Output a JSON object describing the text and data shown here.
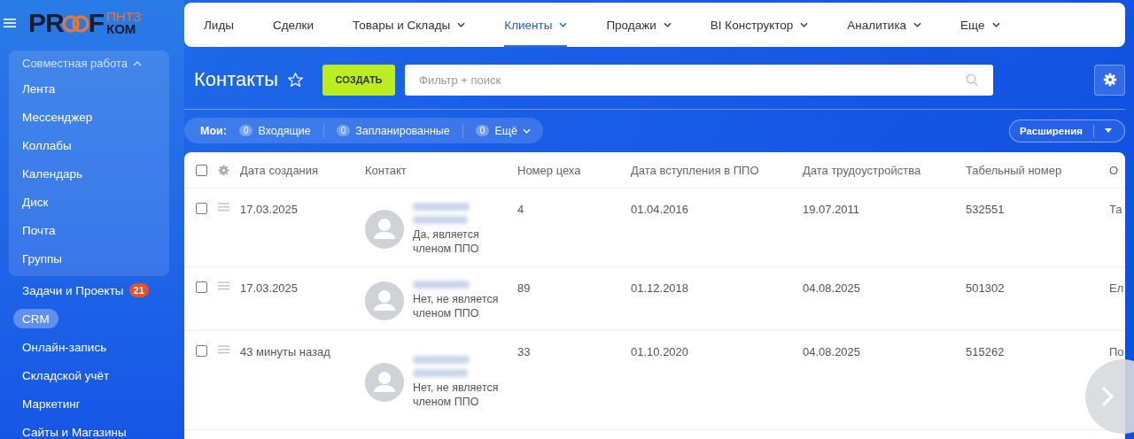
{
  "logo": {
    "left": "PR",
    "right": "F",
    "top": "ПНТЗ",
    "bottom": "КОМ"
  },
  "sidebar": {
    "group": {
      "title": "Совместная работа",
      "expanded": true,
      "items": [
        {
          "label": "Лента"
        },
        {
          "label": "Мессенджер"
        },
        {
          "label": "Коллабы"
        },
        {
          "label": "Календарь"
        },
        {
          "label": "Диск"
        },
        {
          "label": "Почта"
        },
        {
          "label": "Группы"
        }
      ]
    },
    "items": [
      {
        "label": "Задачи и Проекты",
        "badge": "21",
        "selected": false
      },
      {
        "label": "CRM",
        "selected": true
      },
      {
        "label": "Онлайн-запись",
        "selected": false
      },
      {
        "label": "Складской учёт",
        "selected": false
      },
      {
        "label": "Маркетинг",
        "selected": false
      },
      {
        "label": "Сайты и Магазины",
        "selected": false
      }
    ]
  },
  "nav": [
    {
      "label": "Лиды",
      "dropdown": false,
      "selected": false
    },
    {
      "label": "Сделки",
      "dropdown": false,
      "selected": false
    },
    {
      "label": "Товары и Склады",
      "dropdown": true,
      "selected": false
    },
    {
      "label": "Клиенты",
      "dropdown": true,
      "selected": true
    },
    {
      "label": "Продажи",
      "dropdown": true,
      "selected": false
    },
    {
      "label": "BI Конструктор",
      "dropdown": true,
      "selected": false
    },
    {
      "label": "Аналитика",
      "dropdown": true,
      "selected": false
    },
    {
      "label": "Еще",
      "dropdown": true,
      "selected": false
    }
  ],
  "page_title": "Контакты",
  "create_button": "СОЗДАТЬ",
  "search": {
    "placeholder": "Фильтр + поиск"
  },
  "counters": {
    "label": "Мои:",
    "items": [
      {
        "count": "0",
        "label": "Входящие",
        "dropdown": false
      },
      {
        "count": "0",
        "label": "Запланированные",
        "dropdown": false
      },
      {
        "count": "0",
        "label": "Ещё",
        "dropdown": true
      }
    ]
  },
  "extensions_button": "Расширения",
  "table": {
    "header_checked": false,
    "columns": [
      "Дата создания",
      "Контакт",
      "Номер цеха",
      "Дата вступления в ППО",
      "Дата трудоустройства",
      "Табельный номер",
      "О"
    ],
    "rows": [
      {
        "checked": false,
        "created": "17.03.2025",
        "name_wraps": true,
        "membership": "Да, является членом ППО",
        "workshop": "4",
        "joined": "01.04.2016",
        "employed": "19.07.2011",
        "number": "532551",
        "column_7": "Та"
      },
      {
        "checked": false,
        "created": "17.03.2025",
        "name_wraps": false,
        "membership": "Нет, не является членом ППО",
        "workshop": "89",
        "joined": "01.12.2018",
        "employed": "04.08.2025",
        "number": "501302",
        "column_7": "Ел"
      },
      {
        "checked": false,
        "created": "43 минуты назад",
        "name_wraps": true,
        "membership": "Нет, не является членом ППО",
        "workshop": "33",
        "joined": "01.10.2020",
        "employed": "04.08.2025",
        "number": "515262",
        "column_7": "По"
      }
    ]
  }
}
